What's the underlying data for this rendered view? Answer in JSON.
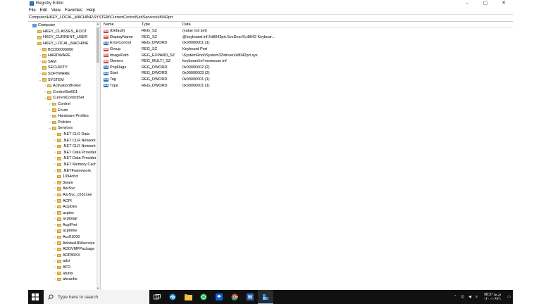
{
  "window": {
    "title": "Registry Editor",
    "controls": [
      "–",
      "▢",
      "✕"
    ]
  },
  "menu": [
    "File",
    "Edit",
    "View",
    "Favorites",
    "Help"
  ],
  "address": "Computer\\HKEY_LOCAL_MACHINE\\SYSTEM\\CurrentControlSet\\Services\\i8042prt",
  "tree": [
    {
      "label": "Computer",
      "depth": 0,
      "exp": "",
      "kind": "computer"
    },
    {
      "label": "HKEY_CLASSES_ROOT",
      "depth": 1,
      "exp": "",
      "kind": "folder"
    },
    {
      "label": "HKEY_CURRENT_USER",
      "depth": 1,
      "exp": "",
      "kind": "folder"
    },
    {
      "label": "HKEY_LOCAL_MACHINE",
      "depth": 1,
      "exp": "",
      "kind": "folder"
    },
    {
      "label": "BCD00000000",
      "depth": 2,
      "exp": ">",
      "kind": "folder"
    },
    {
      "label": "HARDWARE",
      "depth": 2,
      "exp": ">",
      "kind": "folder"
    },
    {
      "label": "SAM",
      "depth": 2,
      "exp": ">",
      "kind": "folder"
    },
    {
      "label": "SECURITY",
      "depth": 2,
      "exp": "",
      "kind": "folder"
    },
    {
      "label": "SOFTWARE",
      "depth": 2,
      "exp": ">",
      "kind": "folder"
    },
    {
      "label": "SYSTEM",
      "depth": 2,
      "exp": "v",
      "kind": "folder"
    },
    {
      "label": "ActivationBroker",
      "depth": 3,
      "exp": ">",
      "kind": "folder"
    },
    {
      "label": "ControlSet001",
      "depth": 3,
      "exp": ">",
      "kind": "folder"
    },
    {
      "label": "CurrentControlSet",
      "depth": 3,
      "exp": "v",
      "kind": "folder"
    },
    {
      "label": "Control",
      "depth": 4,
      "exp": ">",
      "kind": "folder"
    },
    {
      "label": "Enum",
      "depth": 4,
      "exp": ">",
      "kind": "folder"
    },
    {
      "label": "Hardware Profiles",
      "depth": 4,
      "exp": ">",
      "kind": "folder"
    },
    {
      "label": "Policies",
      "depth": 4,
      "exp": ">",
      "kind": "folder"
    },
    {
      "label": "Services",
      "depth": 4,
      "exp": "v",
      "kind": "folder"
    },
    {
      "label": ".NET CLR Data",
      "depth": 5,
      "exp": ">",
      "kind": "folder"
    },
    {
      "label": ".NET CLR Networkin",
      "depth": 5,
      "exp": ">",
      "kind": "folder"
    },
    {
      "label": ".NET CLR Networkin",
      "depth": 5,
      "exp": ">",
      "kind": "folder"
    },
    {
      "label": ".NET Data Provider f",
      "depth": 5,
      "exp": ">",
      "kind": "folder"
    },
    {
      "label": ".NET Data Provider f",
      "depth": 5,
      "exp": ">",
      "kind": "folder"
    },
    {
      "label": ".NET Memory Cache",
      "depth": 5,
      "exp": ">",
      "kind": "folder"
    },
    {
      "label": ".NETFramework",
      "depth": 5,
      "exp": ">",
      "kind": "folder"
    },
    {
      "label": "1394ohci",
      "depth": 5,
      "exp": "",
      "kind": "folder"
    },
    {
      "label": "3ware",
      "depth": 5,
      "exp": ">",
      "kind": "folder"
    },
    {
      "label": "AarSvc",
      "depth": 5,
      "exp": ">",
      "kind": "folder"
    },
    {
      "label": "AarSvc_c651cee",
      "depth": 5,
      "exp": ">",
      "kind": "folder"
    },
    {
      "label": "ACPI",
      "depth": 5,
      "exp": ">",
      "kind": "folder"
    },
    {
      "label": "AcpiDev",
      "depth": 5,
      "exp": ">",
      "kind": "folder"
    },
    {
      "label": "acpiex",
      "depth": 5,
      "exp": ">",
      "kind": "folder"
    },
    {
      "label": "acpipagr",
      "depth": 5,
      "exp": ">",
      "kind": "folder"
    },
    {
      "label": "AcpiPmi",
      "depth": 5,
      "exp": ">",
      "kind": "folder"
    },
    {
      "label": "acpitime",
      "depth": 5,
      "exp": ">",
      "kind": "folder"
    },
    {
      "label": "Acx01000",
      "depth": 5,
      "exp": ">",
      "kind": "folder"
    },
    {
      "label": "AdobeARMservice",
      "depth": 5,
      "exp": ">",
      "kind": "folder"
    },
    {
      "label": "ADOVMPPackage",
      "depth": 5,
      "exp": ">",
      "kind": "folder"
    },
    {
      "label": "ADP80XX",
      "depth": 5,
      "exp": ">",
      "kind": "folder"
    },
    {
      "label": "adsi",
      "depth": 5,
      "exp": ">",
      "kind": "folder"
    },
    {
      "label": "AFD",
      "depth": 5,
      "exp": ">",
      "kind": "folder"
    },
    {
      "label": "afunix",
      "depth": 5,
      "exp": ">",
      "kind": "folder"
    },
    {
      "label": "ahcache",
      "depth": 5,
      "exp": ">",
      "kind": "folder"
    }
  ],
  "columns": {
    "name": "Name",
    "type": "Type",
    "data": "Data"
  },
  "values": [
    {
      "icon": "ab",
      "kind": "sz",
      "name": "(Default)",
      "type": "REG_SZ",
      "data": "(value not set)"
    },
    {
      "icon": "ab",
      "kind": "sz",
      "name": "DisplayName",
      "type": "REG_SZ",
      "data": "@keyboard.inf,%i8042prt.SvcDesc%;i8042 Keyboar..."
    },
    {
      "icon": "01",
      "kind": "bin",
      "name": "ErrorControl",
      "type": "REG_DWORD",
      "data": "0x00000001 (1)"
    },
    {
      "icon": "ab",
      "kind": "sz",
      "name": "Group",
      "type": "REG_SZ",
      "data": "Keyboard Port"
    },
    {
      "icon": "ab",
      "kind": "sz",
      "name": "ImagePath",
      "type": "REG_EXPAND_SZ",
      "data": "\\SystemRoot\\System32\\drivers\\i8042prt.sys"
    },
    {
      "icon": "ab",
      "kind": "sz",
      "name": "Owners",
      "type": "REG_MULTI_SZ",
      "data": "keyboard.inf msmouse.inf"
    },
    {
      "icon": "01",
      "kind": "bin",
      "name": "PnpFlags",
      "type": "REG_DWORD",
      "data": "0x00000002 (2)"
    },
    {
      "icon": "01",
      "kind": "bin",
      "name": "Start",
      "type": "REG_DWORD",
      "data": "0x00000003 (3)"
    },
    {
      "icon": "01",
      "kind": "bin",
      "name": "Tag",
      "type": "REG_DWORD",
      "data": "0x00000001 (1)"
    },
    {
      "icon": "01",
      "kind": "bin",
      "name": "Type",
      "type": "REG_DWORD",
      "data": "0x00000001 (1)"
    }
  ],
  "taskbar": {
    "search_placeholder": "Type here to search",
    "apps": [
      "task-view-icon",
      "edge-icon",
      "file-explorer-icon",
      "whatsapp-icon",
      "dropbox-icon",
      "chrome-icon",
      "word-icon",
      "regedit-icon"
    ],
    "clock_time": "08:37 ق.ظ",
    "clock_date": "۱۴۰۰/۰۶/۲۱"
  }
}
